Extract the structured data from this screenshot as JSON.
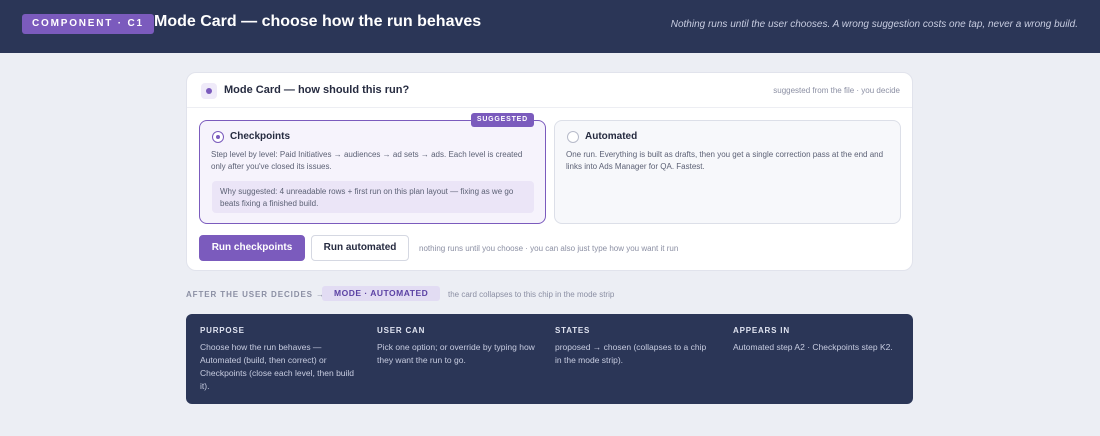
{
  "header": {
    "badge": "COMPONENT · C1",
    "title": "Mode Card — choose how the run behaves",
    "note": "Nothing runs until the user chooses. A wrong suggestion costs one tap, never a wrong build."
  },
  "card": {
    "title": "Mode Card — how should this run?",
    "hint": "suggested from the file · you decide",
    "options": [
      {
        "title": "Checkpoints",
        "selected": true,
        "badge": "SUGGESTED",
        "description": "Step level by level: Paid Initiatives → audiences → ad sets → ads. Each level is created only after you've closed its issues.",
        "why": "Why suggested: 4 unreadable rows + first run on this plan layout — fixing as we go beats fixing a finished build."
      },
      {
        "title": "Automated",
        "selected": false,
        "description": "One run. Everything is built as drafts, then you get a single correction pass at the end and links into Ads Manager for QA. Fastest."
      }
    ],
    "primary_button": "Run checkpoints",
    "secondary_button": "Run automated",
    "actions_note": "nothing runs until you choose · you can also just type how you want it run"
  },
  "after": {
    "label": "AFTER THE USER DECIDES →",
    "chip": "MODE · AUTOMATED",
    "note": "the card collapses to this chip in the mode strip"
  },
  "info": [
    {
      "label": "PURPOSE",
      "text": "Choose how the run behaves — Automated (build, then correct) or Checkpoints (close each level, then build it)."
    },
    {
      "label": "USER CAN",
      "text": "Pick one option; or override by typing how they want the run to go."
    },
    {
      "label": "STATES",
      "text": "proposed → chosen (collapses to a chip in the mode strip)."
    },
    {
      "label": "APPEARS IN",
      "text": "Automated step A2 · Checkpoints step K2."
    }
  ],
  "colors": {
    "header_bg": "#2b3657",
    "accent": "#7b5bbd",
    "page_bg": "#eceef4"
  },
  "icons": [
    "mode-card-icon",
    "radio-selected-icon",
    "radio-unselected-icon"
  ]
}
